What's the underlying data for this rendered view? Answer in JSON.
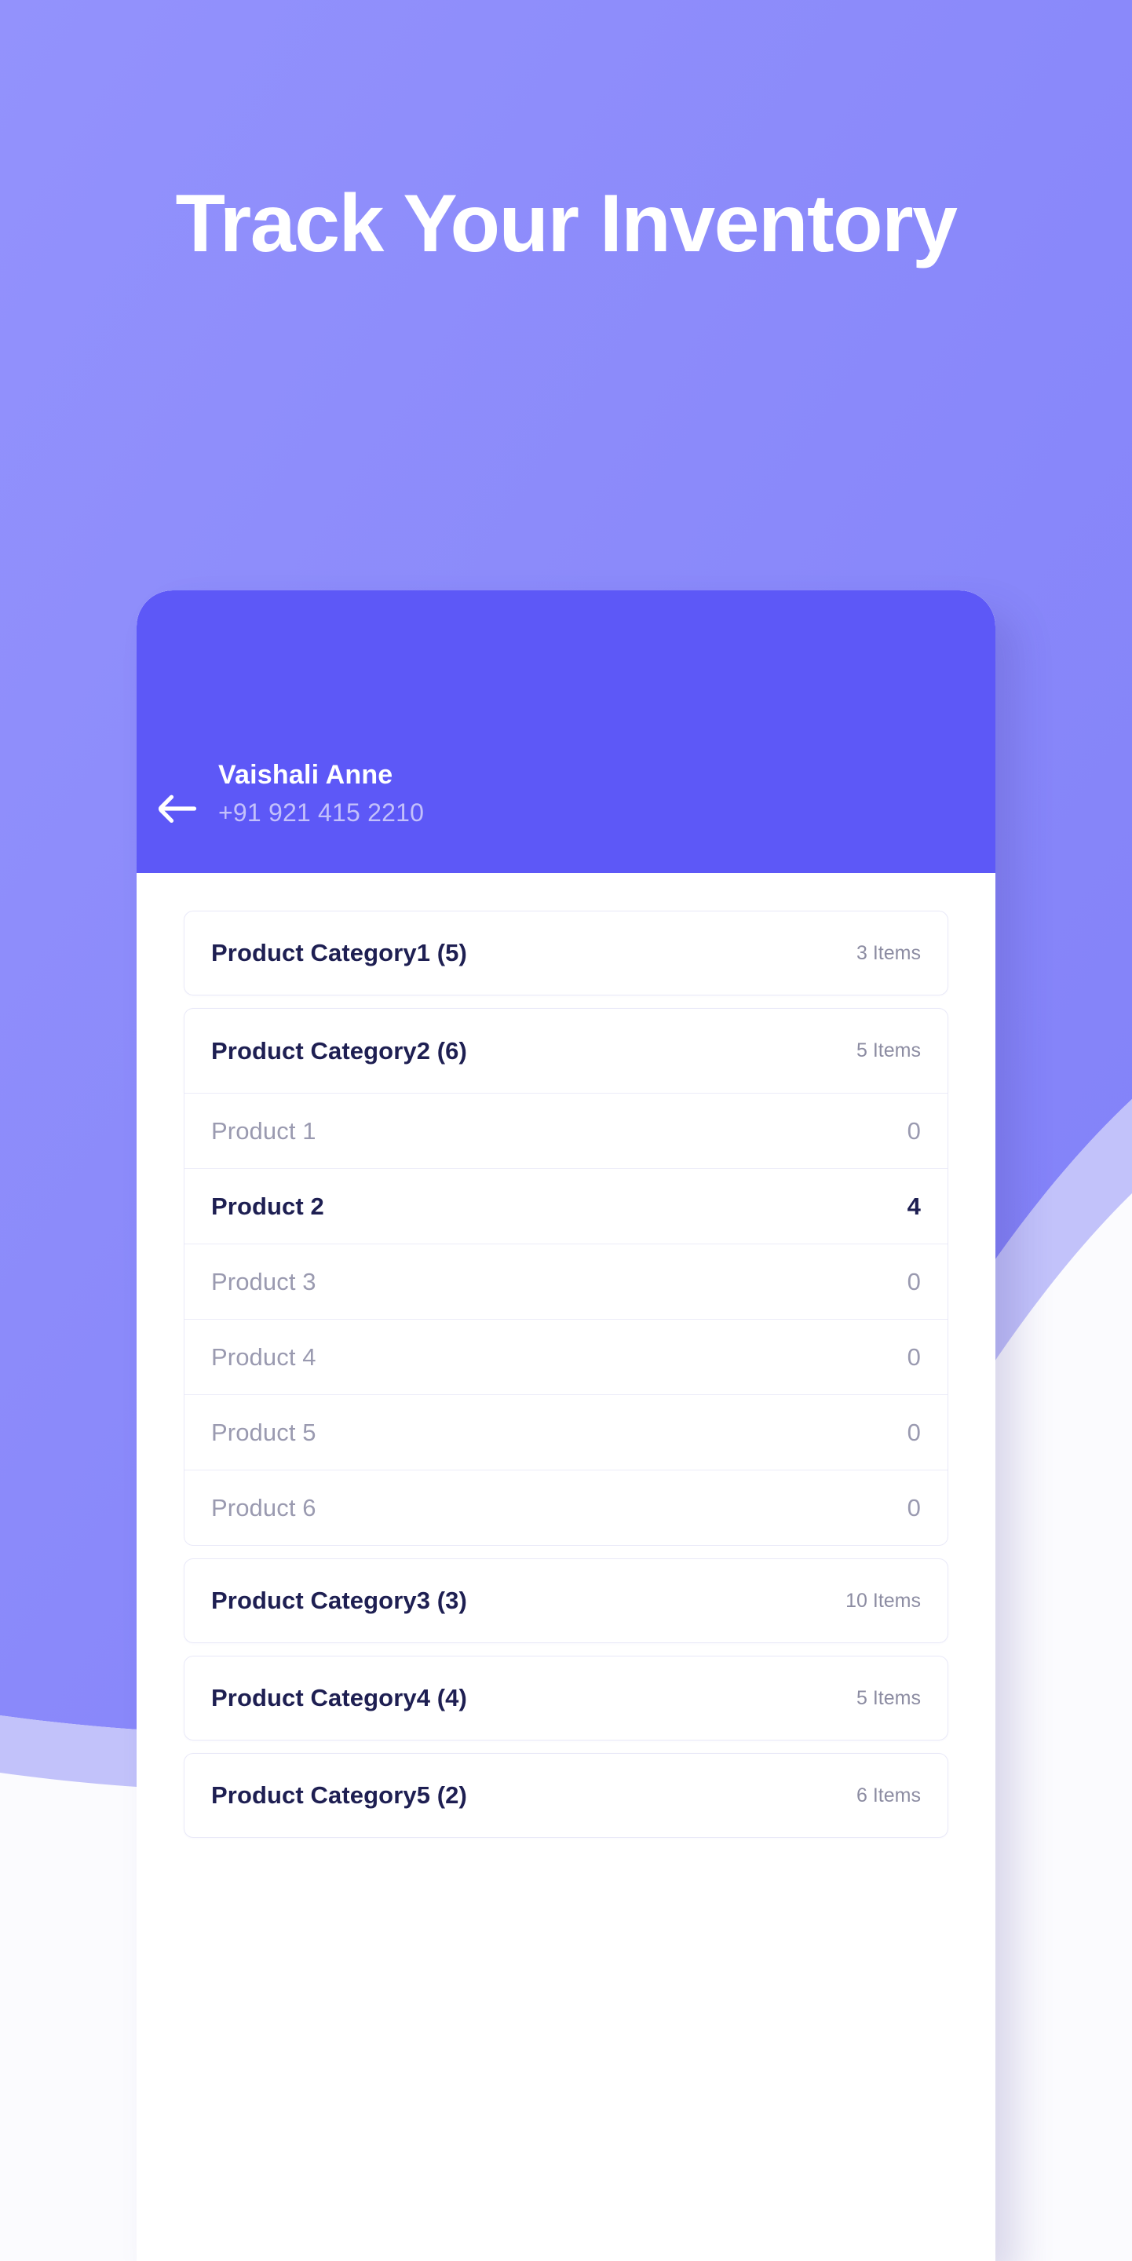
{
  "hero": {
    "title": "Track Your Inventory"
  },
  "colors": {
    "background_purple": "#8c8bfb",
    "header_purple": "#5d58f7",
    "band_light_purple": "#c2c2fa",
    "card_border": "#e9e9f8",
    "text_dark": "#1e1f52",
    "text_muted": "#8c8ca2",
    "text_disabled": "#9a9ab0",
    "phone_white": "#ffffff"
  },
  "app": {
    "header": {
      "back_icon": "arrow-left-icon",
      "name": "Vaishali Anne",
      "phone": "+91 921 415 2210"
    },
    "list": [
      {
        "type": "category",
        "name": "Product Category1 (5)",
        "count": "3 Items",
        "expanded": false,
        "products": []
      },
      {
        "type": "category",
        "name": "Product Category2 (6)",
        "count": "5 Items",
        "expanded": true,
        "products": [
          {
            "name": "Product 1",
            "qty": "0",
            "in_stock": false
          },
          {
            "name": "Product 2",
            "qty": "4",
            "in_stock": true
          },
          {
            "name": "Product 3",
            "qty": "0",
            "in_stock": false
          },
          {
            "name": "Product 4",
            "qty": "0",
            "in_stock": false
          },
          {
            "name": "Product 5",
            "qty": "0",
            "in_stock": false
          },
          {
            "name": "Product 6",
            "qty": "0",
            "in_stock": false
          }
        ]
      },
      {
        "type": "category",
        "name": "Product Category3 (3)",
        "count": "10 Items",
        "expanded": false,
        "products": []
      },
      {
        "type": "category",
        "name": "Product Category4 (4)",
        "count": "5 Items",
        "expanded": false,
        "products": []
      },
      {
        "type": "category",
        "name": "Product Category5 (2)",
        "count": "6 Items",
        "expanded": false,
        "products": []
      }
    ]
  }
}
